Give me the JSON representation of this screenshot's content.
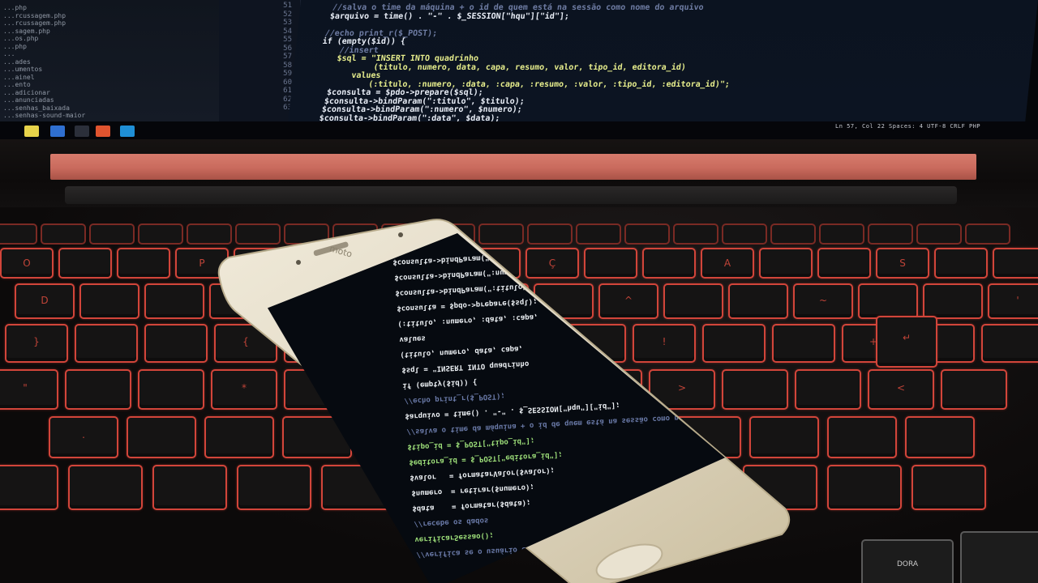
{
  "laptop": {
    "file_tree": [
      "...php",
      "...rcussagem.php",
      "...rcussagem.php",
      "...sagem.php",
      "...os.php",
      "...php",
      "...",
      "...ades",
      "...umentos",
      "...ainel",
      "...ento",
      "...adicionar",
      "...anunciadas",
      "...senhas_baixada",
      "...senhas-sound-maior"
    ],
    "line_numbers": [
      "51",
      "52",
      "53",
      "54",
      "55",
      "56",
      "57",
      "58",
      "59",
      "60",
      "61",
      "62",
      "63"
    ],
    "code_lines": [
      {
        "text": "//salva o time da máquina + o id de quem está na sessão como nome do arquivo",
        "cls": "c-comment"
      },
      {
        "text": "$arquivo = time() . \"-\" . $_SESSION[\"hqu\"][\"id\"];",
        "cls": "c-var"
      },
      {
        "text": "",
        "cls": "c-var"
      },
      {
        "text": "//echo print_r($_POST);",
        "cls": "c-comment"
      },
      {
        "text": "if (empty($id)) {",
        "cls": "c-var"
      },
      {
        "text": "    //insert",
        "cls": "c-comment"
      },
      {
        "text": "    $sql = \"INSERT INTO quadrinho",
        "cls": "c-str"
      },
      {
        "text": "            (titulo, numero, data, capa, resumo, valor, tipo_id, editora_id)",
        "cls": "c-str"
      },
      {
        "text": "        values",
        "cls": "c-str"
      },
      {
        "text": "            (:titulo, :numero, :data, :capa, :resumo, :valor, :tipo_id, :editora_id)\";",
        "cls": "c-str"
      },
      {
        "text": "    $consulta = $pdo->prepare($sql);",
        "cls": "c-var"
      },
      {
        "text": "    $consulta->bindParam(\":titulo\", $titulo);",
        "cls": "c-var"
      },
      {
        "text": "    $consulta->bindParam(\":numero\", $numero);",
        "cls": "c-var"
      },
      {
        "text": "    $consulta->bindParam(\":data\", $data);",
        "cls": "c-var"
      }
    ],
    "status_text": "Ln 57, Col 22    Spaces: 4    UTF-8    CRLF    PHP"
  },
  "keyboard": {
    "enter_key": "↵",
    "key_legends": [
      "O",
      "P",
      "L",
      "Ç",
      "A",
      "S",
      "D",
      "W",
      "?",
      "^",
      "~",
      "'",
      "}",
      "{",
      "/",
      "!",
      "+",
      "\"",
      "*",
      ":",
      ">",
      "<",
      "."
    ],
    "num_pad_label": "DORA"
  },
  "phone": {
    "brand": "moto",
    "code_lines": [
      {
        "text": "$consulta->bindParam(\":data\", $data);",
        "cls": "ph-white"
      },
      {
        "text": "$consulta->bindParam(\":numero\", $numero);",
        "cls": "ph-white"
      },
      {
        "text": "$consulta->bindParam(\":titulo\", $titulo);",
        "cls": "ph-white"
      },
      {
        "text": "$consulta = $pdo->prepare($sql);",
        "cls": "ph-white"
      },
      {
        "text": "(:titulo, :numero, :data, :capa,",
        "cls": "ph-white"
      },
      {
        "text": "values",
        "cls": "ph-white"
      },
      {
        "text": "(titulo, numero, data, capa,",
        "cls": "ph-white"
      },
      {
        "text": "$sql = \"INSERT INTO quadrinho",
        "cls": "ph-white"
      },
      {
        "text": "if (empty($id)) {",
        "cls": "ph-white"
      },
      {
        "text": "//echo print_r($_POST);",
        "cls": "ph-blue"
      },
      {
        "text": "$arquivo = time() . \"-\" . $_SESSION[\"hqu\"][\"id\"];",
        "cls": "ph-white"
      },
      {
        "text": "//salva o time da máquina + o id de quem está na sessão como nome do arquivo",
        "cls": "ph-blue"
      },
      {
        "text": "$tipo_id = $_POST[\"tipo_id\"];",
        "cls": "ph-green"
      },
      {
        "text": "$editora_id = $_POST[\"editora_id\"];",
        "cls": "ph-green"
      },
      {
        "text": "$valor   = formatarValor($valor);",
        "cls": "ph-white"
      },
      {
        "text": "$numero  = retirar($numero);",
        "cls": "ph-white"
      },
      {
        "text": "$data    = formatar($data);",
        "cls": "ph-white"
      },
      {
        "text": "//recebe os dados",
        "cls": "ph-blue"
      },
      {
        "text": "verificarSessao();",
        "cls": "ph-green"
      },
      {
        "text": "//verifica se o usuário está logado",
        "cls": "ph-blue"
      }
    ]
  },
  "colors": {
    "keyboard_backlight": "#d2453a",
    "hinge_strip": "#c96a5d",
    "phone_body": "#e3dccb",
    "phone_screen": "#060a10"
  }
}
